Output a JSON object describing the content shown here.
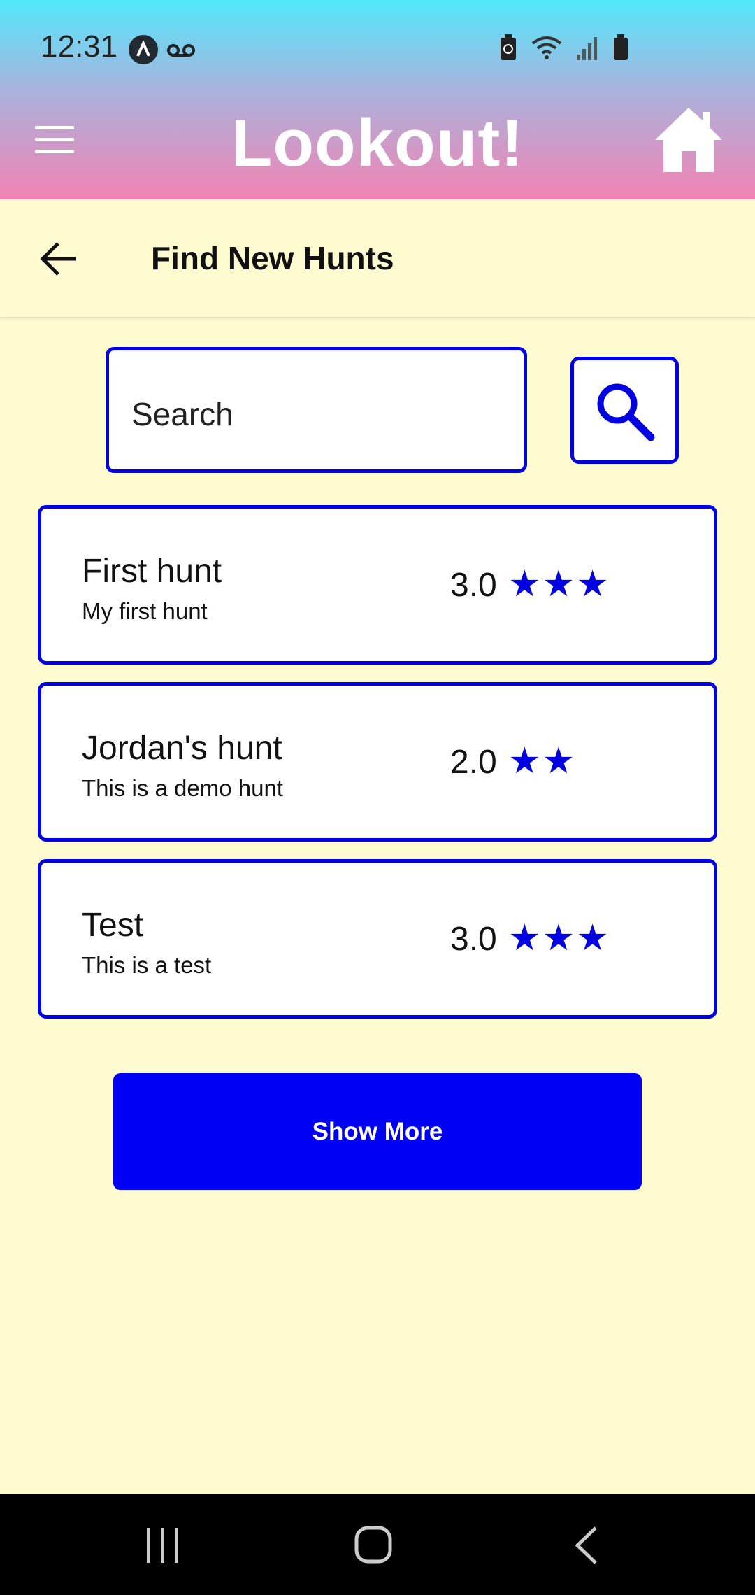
{
  "status_bar": {
    "time": "12:31"
  },
  "header": {
    "app_title": "Lookout!"
  },
  "subheader": {
    "title": "Find New Hunts"
  },
  "search": {
    "placeholder": "Search"
  },
  "hunts": [
    {
      "name": "First hunt",
      "description": "My first hunt",
      "rating": "3.0",
      "stars": "★★★"
    },
    {
      "name": "Jordan's hunt",
      "description": "This is a demo hunt",
      "rating": "2.0",
      "stars": "★★"
    },
    {
      "name": "Test",
      "description": "This is a test",
      "rating": "3.0",
      "stars": "★★★"
    }
  ],
  "show_more_label": "Show More",
  "colors": {
    "accent": "#0000f4",
    "background": "#fefbd0",
    "header_top": "#52e8fb",
    "header_bottom": "#f283b2"
  }
}
